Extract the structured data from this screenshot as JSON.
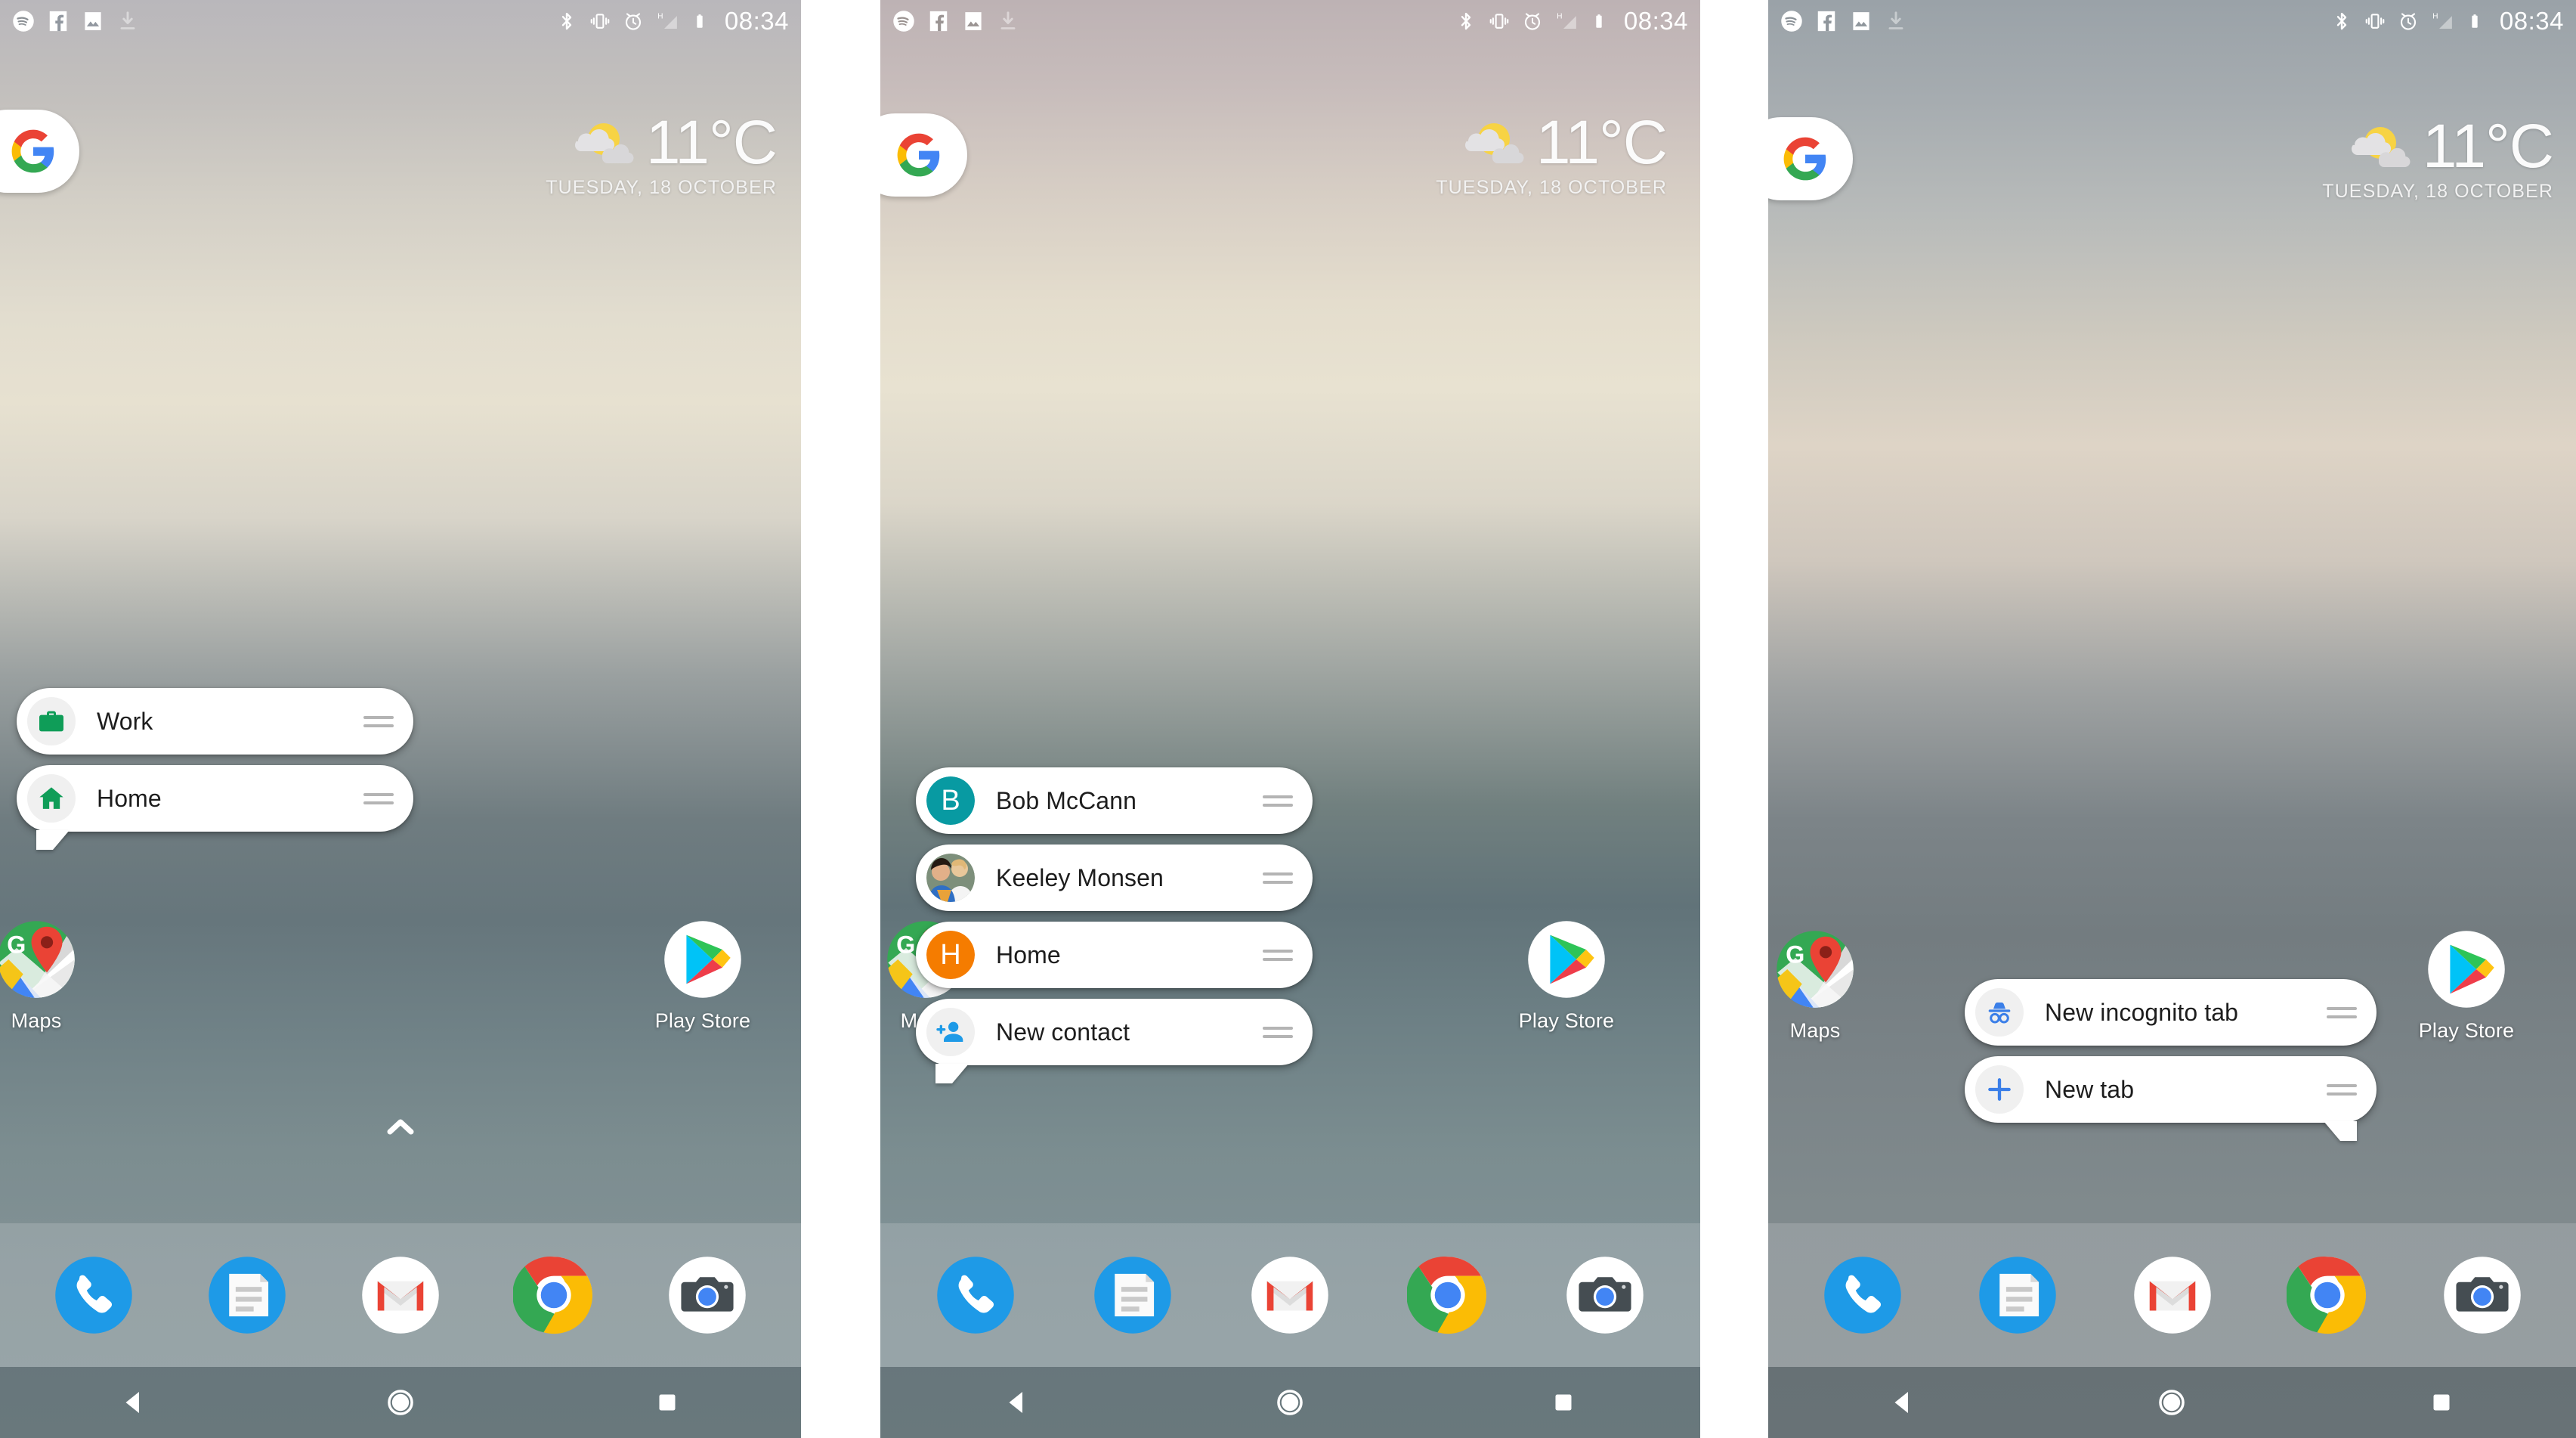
{
  "status_bar": {
    "left_icons": [
      "spotify-icon",
      "facebook-icon",
      "screenshot-icon",
      "download-icon"
    ],
    "right_icons": [
      "bluetooth-icon",
      "vibrate-icon",
      "alarm-icon",
      "signal-h-icon",
      "battery-icon"
    ],
    "network_type": "H",
    "time": "08:34"
  },
  "widgets": {
    "google_search": {
      "icon": "google-g-icon",
      "label": "Google"
    },
    "weather": {
      "icon": "partly-cloudy-icon",
      "temperature": "11°C",
      "date": "TUESDAY, 18 OCTOBER"
    }
  },
  "desktop_icons": {
    "maps": {
      "label": "Maps",
      "icon": "google-maps-icon"
    },
    "play_store": {
      "label": "Play Store",
      "icon": "google-play-icon"
    }
  },
  "drawer": {
    "icon": "chevron-up-icon",
    "label": "All apps"
  },
  "dock": [
    {
      "label": "Phone",
      "icon": "phone-icon"
    },
    {
      "label": "Messages",
      "icon": "messages-icon"
    },
    {
      "label": "Gmail",
      "icon": "gmail-icon"
    },
    {
      "label": "Chrome",
      "icon": "chrome-icon"
    },
    {
      "label": "Camera",
      "icon": "camera-icon"
    }
  ],
  "nav_bar": [
    {
      "label": "Back",
      "icon": "back-triangle-icon"
    },
    {
      "label": "Home",
      "icon": "home-circle-icon"
    },
    {
      "label": "Recents",
      "icon": "recents-square-icon"
    }
  ],
  "panels": [
    {
      "name": "maps-shortcuts",
      "menu_source": "Maps",
      "items": [
        {
          "label": "Work",
          "icon": "briefcase-icon",
          "icon_color": "#0f9d58",
          "drag": "drag-handle-icon"
        },
        {
          "label": "Home",
          "icon": "house-icon",
          "icon_color": "#0f9d58",
          "drag": "drag-handle-icon"
        }
      ]
    },
    {
      "name": "phone-shortcuts",
      "menu_source": "Phone",
      "items": [
        {
          "label": "Bob McCann",
          "icon": "avatar-letter-b",
          "avatar_letter": "B",
          "icon_color": "#089aa2",
          "drag": "drag-handle-icon"
        },
        {
          "label": "Keeley Monsen",
          "icon": "avatar-photo",
          "drag": "drag-handle-icon"
        },
        {
          "label": "Home",
          "icon": "avatar-letter-h",
          "avatar_letter": "H",
          "icon_color": "#f57c00",
          "drag": "drag-handle-icon"
        },
        {
          "label": "New contact",
          "icon": "person-add-icon",
          "icon_color": "#1e9ae7",
          "drag": "drag-handle-icon"
        }
      ]
    },
    {
      "name": "chrome-shortcuts",
      "menu_source": "Chrome",
      "items": [
        {
          "label": "New incognito tab",
          "icon": "incognito-icon",
          "icon_color": "#3b7fe8",
          "drag": "drag-handle-icon"
        },
        {
          "label": "New tab",
          "icon": "plus-icon",
          "icon_color": "#3b7fe8",
          "drag": "drag-handle-icon"
        }
      ]
    }
  ],
  "colors": {
    "google_blue": "#4285f4",
    "google_red": "#ea4335",
    "google_yellow": "#fbbc05",
    "google_green": "#34a853",
    "maps_green": "#0f9d58",
    "accent_blue": "#1e9ae7",
    "teal": "#089aa2",
    "orange": "#f57c00"
  }
}
